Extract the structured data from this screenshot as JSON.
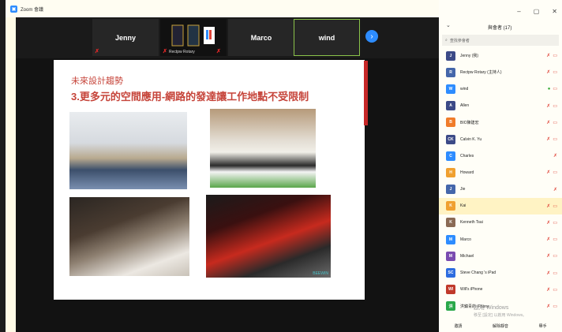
{
  "window": {
    "title": "Zoom 會議",
    "controls": [
      "–",
      "▢",
      "✕"
    ]
  },
  "video_strip": {
    "tiles": [
      {
        "label": "Jenny"
      },
      {
        "label": "Rectpw Rotary"
      },
      {
        "label": "Marco"
      },
      {
        "label": "wind"
      }
    ]
  },
  "slide": {
    "title": "未來設計趨勢",
    "subtitle": "3.更多元的空間應用-網路的發達讓工作地點不受限制",
    "watermark": "BEEWIN"
  },
  "participants": {
    "header": "與會者 (17)",
    "search_placeholder": "查找參會者",
    "items": [
      {
        "initials": "J",
        "name": "Jenny (我)",
        "color": "#3c4a87"
      },
      {
        "initials": "R",
        "name": "Rectpw Rotary (主持人)",
        "color": "#4466aa"
      },
      {
        "initials": "W",
        "name": "wind",
        "color": "#2d8cff"
      },
      {
        "initials": "A",
        "name": "Allen",
        "color": "#3c4a87"
      },
      {
        "initials": "B",
        "name": "BIO陳建宏",
        "color": "#f07c2b"
      },
      {
        "initials": "CK",
        "name": "Calvin K. Yu",
        "color": "#3c4a87"
      },
      {
        "initials": "C",
        "name": "Charles",
        "color": "#2d8cff"
      },
      {
        "initials": "H",
        "name": "Howard",
        "color": "#f0a030"
      },
      {
        "initials": "J",
        "name": "Jie",
        "color": "#4466aa"
      },
      {
        "initials": "K",
        "name": "Kai",
        "color": "#f0a030"
      },
      {
        "initials": "K",
        "name": "Kenneth Tsai",
        "color": "#8a6a55"
      },
      {
        "initials": "M",
        "name": "Marco",
        "color": "#2d8cff"
      },
      {
        "initials": "M",
        "name": "Michael",
        "color": "#7a4bb0"
      },
      {
        "initials": "SC",
        "name": "Steve Chang 's iPad",
        "color": "#2d6cdf"
      },
      {
        "initials": "WI",
        "name": "Will's iPhone",
        "color": "#c0392b"
      },
      {
        "initials": "洪",
        "name": "洪鎮青的 iPhone",
        "color": "#2aa84a"
      }
    ],
    "footer": [
      "邀請",
      "解除靜音",
      "舉手"
    ]
  },
  "windows_watermark": {
    "line1": "啟用 Windows",
    "line2": "移至 [設定] 以啟用 Windows。"
  }
}
